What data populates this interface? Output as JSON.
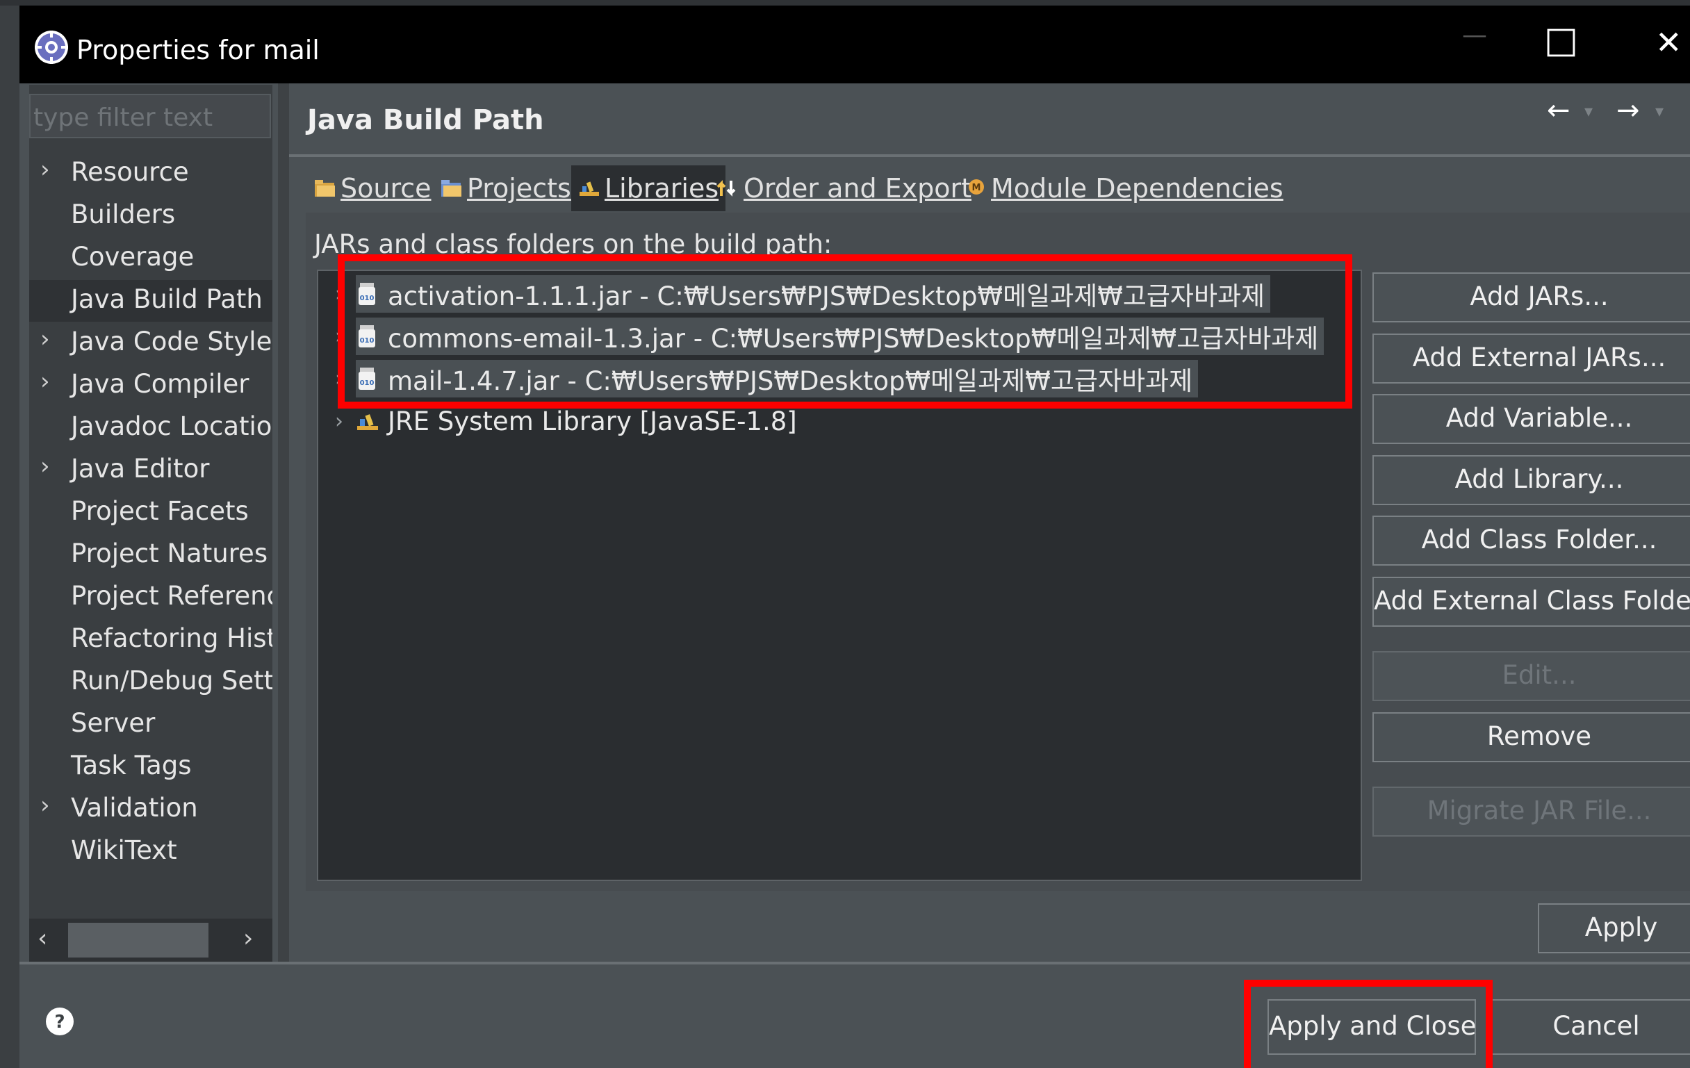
{
  "window": {
    "title": "Properties for mail",
    "controls": {
      "minimize": "—",
      "maximize": "□",
      "close": "✕"
    }
  },
  "sidebar": {
    "filter_placeholder": "type filter text",
    "items": [
      {
        "label": "Resource",
        "expandable": true
      },
      {
        "label": "Builders",
        "expandable": false
      },
      {
        "label": "Coverage",
        "expandable": false
      },
      {
        "label": "Java Build Path",
        "expandable": false,
        "selected": true
      },
      {
        "label": "Java Code Style",
        "expandable": true
      },
      {
        "label": "Java Compiler",
        "expandable": true
      },
      {
        "label": "Javadoc Location",
        "expandable": false
      },
      {
        "label": "Java Editor",
        "expandable": true
      },
      {
        "label": "Project Facets",
        "expandable": false
      },
      {
        "label": "Project Natures",
        "expandable": false
      },
      {
        "label": "Project References",
        "expandable": false
      },
      {
        "label": "Refactoring History",
        "expandable": false
      },
      {
        "label": "Run/Debug Settings",
        "expandable": false
      },
      {
        "label": "Server",
        "expandable": false
      },
      {
        "label": "Task Tags",
        "expandable": false
      },
      {
        "label": "Validation",
        "expandable": true
      },
      {
        "label": "WikiText",
        "expandable": false
      }
    ]
  },
  "page": {
    "title": "Java Build Path",
    "tabs": [
      {
        "label": "Source",
        "icon": "source-folder-icon"
      },
      {
        "label": "Projects",
        "icon": "projects-folder-icon"
      },
      {
        "label": "Libraries",
        "icon": "libraries-icon",
        "selected": true
      },
      {
        "label": "Order and Export",
        "icon": "order-export-icon"
      },
      {
        "label": "Module Dependencies",
        "icon": "module-icon"
      }
    ],
    "list_caption": "JARs and class folders on the build path:",
    "entries": [
      {
        "label": "activation-1.1.1.jar - C:₩Users₩PJS₩Desktop₩메일과제₩고급자바과제",
        "icon": "jar-icon",
        "highlighted": true
      },
      {
        "label": "commons-email-1.3.jar - C:₩Users₩PJS₩Desktop₩메일과제₩고급자바과제",
        "icon": "jar-icon",
        "highlighted": true
      },
      {
        "label": "mail-1.4.7.jar - C:₩Users₩PJS₩Desktop₩메일과제₩고급자바과제",
        "icon": "jar-icon",
        "highlighted": true
      },
      {
        "label": "JRE System Library [JavaSE-1.8]",
        "icon": "library-icon",
        "highlighted": false
      }
    ],
    "buttons": {
      "add_jars": "Add JARs...",
      "add_external_jars": "Add External JARs...",
      "add_variable": "Add Variable...",
      "add_library": "Add Library...",
      "add_class_folder": "Add Class Folder...",
      "add_external_class_folder": "Add External Class Folder...",
      "edit": "Edit...",
      "remove": "Remove",
      "migrate_jar": "Migrate JAR File..."
    },
    "apply": "Apply"
  },
  "footer": {
    "apply_and_close": "Apply and Close",
    "cancel": "Cancel"
  },
  "colors": {
    "highlight_box": "#ff0000",
    "dialog_bg": "#4b5155",
    "titlebar_bg": "#000000"
  }
}
